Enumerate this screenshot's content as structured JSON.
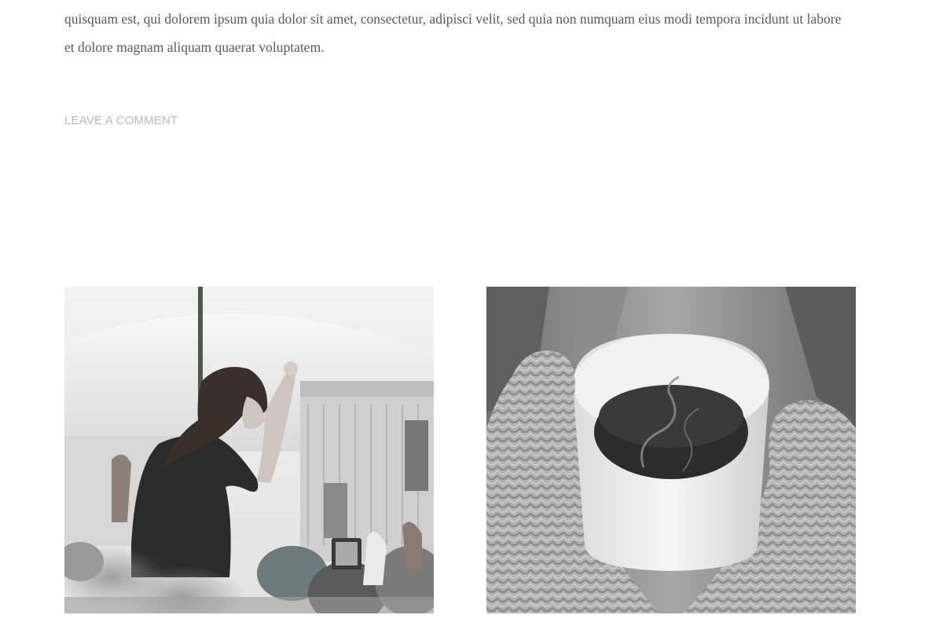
{
  "post": {
    "text_lines": [
      "quisquam est, qui dolorem ipsum quia dolor sit amet, consectetur, adipisci velit, sed quia non numquam eius modi tempora incidunt ut labore",
      "et dolore magnam aliquam quaerat voluptatem."
    ],
    "comment_link": "LEAVE A COMMENT"
  },
  "gallery": {
    "images": [
      {
        "subject": "concert-crowd-photo"
      },
      {
        "subject": "hot-coffee-mittens-photo"
      }
    ]
  }
}
